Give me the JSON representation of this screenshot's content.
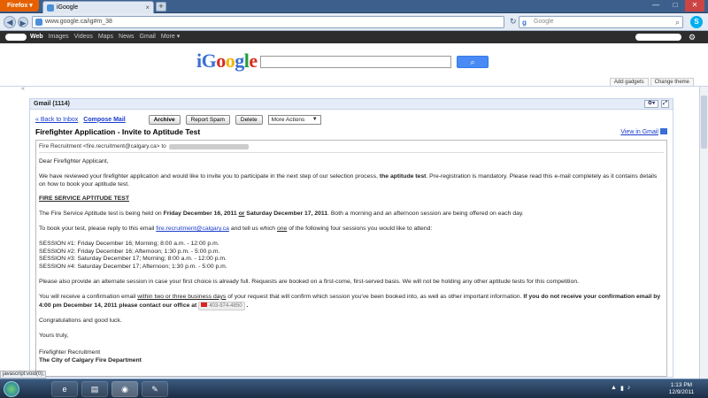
{
  "browser": {
    "app_button": "Firefox",
    "tab_title": "iGoogle",
    "tab_close": "×",
    "new_tab": "+",
    "url": "www.google.ca/ig#m_38",
    "search_placeholder": "Google",
    "skype_letter": "S"
  },
  "gbar": {
    "links": [
      "Web",
      "Images",
      "Videos",
      "Maps",
      "News",
      "Gmail",
      "More ▾"
    ],
    "active": "Web"
  },
  "header": {
    "logo_letters": [
      "i",
      "G",
      "o",
      "o",
      "g",
      "l",
      "e"
    ],
    "logo_colors": [
      "#3b6fd4",
      "#3b6fd4",
      "#d62d20",
      "#f4b400",
      "#3b6fd4",
      "#1e9f3e",
      "#d62d20"
    ],
    "add_gadgets": "Add gadgets",
    "change_theme": "Change theme"
  },
  "gadget": {
    "title": "Gmail (1114)",
    "back_link": "« Back to Inbox",
    "compose": "Compose Mail",
    "archive": "Archive",
    "report_spam": "Report Spam",
    "delete": "Delete",
    "more_actions": "More Actions",
    "subject": "Firefighter Application - Invite to Aptitude Test",
    "view_in_gmail": "View in Gmail",
    "from_text": "Fire Recruitment <fire.recruitment@calgary.ca> to"
  },
  "email": {
    "greeting": "Dear Firefighter Applicant,",
    "p1_a": "We have reviewed your firefighter application and would like to invite you to participate in the next step of our selection process,",
    "p1_bold": "the aptitude test",
    "p1_b": ". Pre-registration is mandatory.  Please read this e-mail completely as it contains details on how to book your aptitude test.",
    "heading": "FIRE SERVICE APTITUDE TEST",
    "p2_a": "The Fire Service Aptitude test is being held on",
    "p2_bold1": "Friday December 16, 2011",
    "p2_or": "or",
    "p2_bold2": "Saturday December 17, 2011",
    "p2_b": ".  Both a morning and an afternoon session are being offered on each day.",
    "p3_a": "To book your test, please reply to this email",
    "p3_link": "fire.recruitment@calgary.ca",
    "p3_b": "and tell us which",
    "p3_one": "one",
    "p3_c": "of the following four sessions you would like to attend:",
    "sessions": [
      "SESSION #1:  Friday December 16; Morning; 8:00 a.m. - 12:00 p.m.",
      "SESSION #2:  Friday December 16; Afternoon; 1:30 p.m. - 5:00 p.m.",
      "SESSION #3:  Saturday December 17; Morning; 8:00 a.m. - 12:00 p.m.",
      "SESSION #4:  Saturday December 17; Afternoon; 1:30 p.m. - 5:00 p.m."
    ],
    "p4": "Please also provide an alternate session in case your first choice is already full.  Requests are booked on a first-come, first-served basis. We will not be holding any other aptitude tests for this competition.",
    "p5_a": "You will receive a confirmation email",
    "p5_u": "within two or three business days",
    "p5_b": "of your request that will confirm which session you've been booked into, as well as other important information.",
    "p5_bold": "If you do not receive your confirmation email by 4:00 pm December 14, 2011 please contact our office at",
    "phone": "403-974-4850",
    "p6": "Congratulations and good luck.",
    "p7": "Yours truly,",
    "sig1": "Firefighter Recruitment",
    "sig2": "The City of Calgary Fire Department"
  },
  "status_text": "javascript:void(0);",
  "clock": {
    "time": "1:13 PM",
    "date": "12/9/2011"
  }
}
